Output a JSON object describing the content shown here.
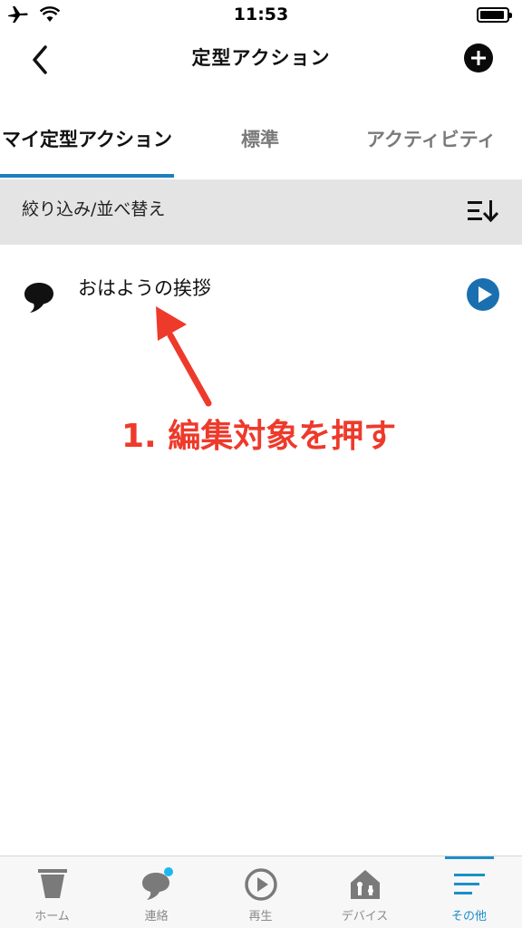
{
  "status_bar": {
    "time": "11:53",
    "icons": [
      "airplane-icon",
      "wifi-icon",
      "battery-icon"
    ]
  },
  "nav": {
    "title": "定型アクション",
    "back_icon": "chevron-left-icon",
    "add_icon": "plus-circle-icon"
  },
  "tabs": [
    {
      "label": "マイ定型アクション",
      "active": true
    },
    {
      "label": "標準",
      "active": false
    },
    {
      "label": "アクティビティ",
      "active": false
    }
  ],
  "filter": {
    "label": "絞り込み/並べ替え",
    "icon": "sort-icon"
  },
  "routines": [
    {
      "label": "おはようの挨拶",
      "icon": "speech-bubble-icon",
      "action_icon": "play-icon"
    }
  ],
  "annotation": {
    "text": "1. 編集対象を押す",
    "color": "#ee3a2b"
  },
  "bottom_nav": [
    {
      "label": "ホーム",
      "icon": "echo-device-icon",
      "active": false
    },
    {
      "label": "連絡",
      "icon": "chat-bubble-icon",
      "active": false,
      "badge": true
    },
    {
      "label": "再生",
      "icon": "play-circle-icon",
      "active": false
    },
    {
      "label": "デバイス",
      "icon": "home-devices-icon",
      "active": false
    },
    {
      "label": "その他",
      "icon": "menu-lines-icon",
      "active": true
    }
  ],
  "colors": {
    "accent": "#1a8fc9",
    "tab_underline": "#1a7fbf",
    "filter_bg": "#e4e4e4",
    "play_button": "#1a6fb0"
  }
}
